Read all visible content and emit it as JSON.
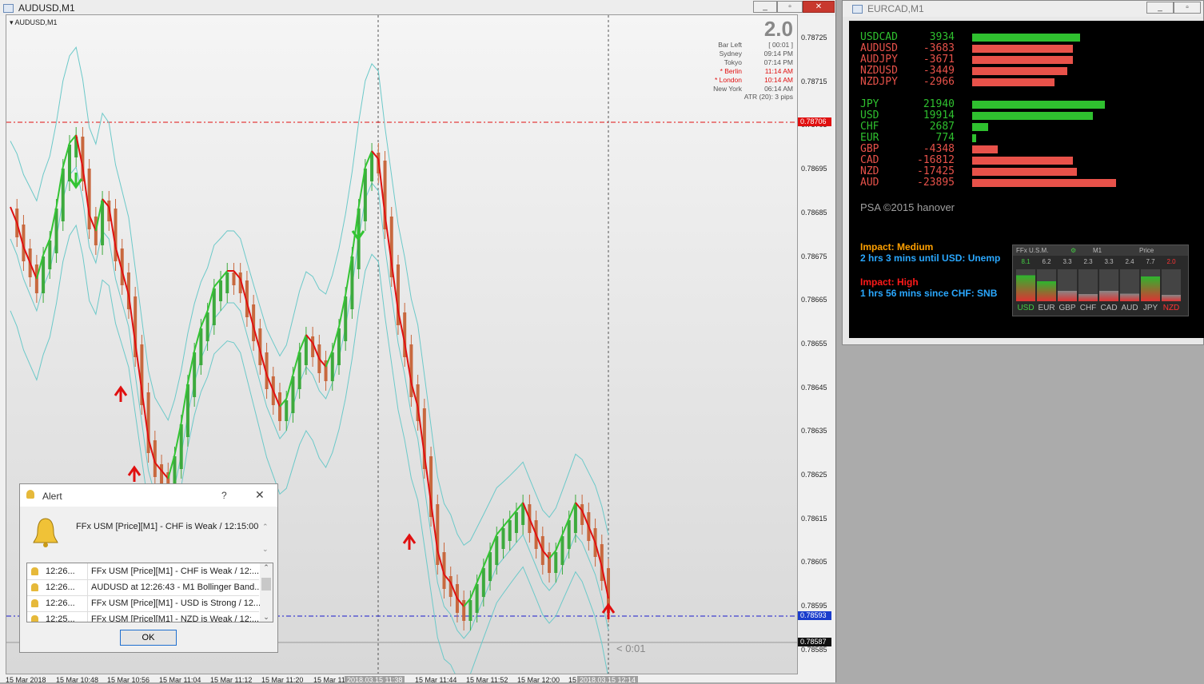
{
  "main_window": {
    "title": "AUDUSD,M1",
    "symbol_label": "AUDUSD,M1",
    "panel_value": "2.0",
    "info": {
      "bar_left_label": "Bar Left",
      "bar_left_value": "[ 00:01 ]",
      "timezones": [
        {
          "name": "Sydney",
          "time": "09:14 PM",
          "active": false
        },
        {
          "name": "Tokyo",
          "time": "07:14 PM",
          "active": false
        },
        {
          "name": "* Berlin",
          "time": "11:14 AM",
          "active": true
        },
        {
          "name": "* London",
          "time": "10:14 AM",
          "active": true
        },
        {
          "name": "New York",
          "time": "06:14 AM",
          "active": false
        }
      ],
      "atr": "ATR (20): 3 pips"
    },
    "price_axis": [
      "0.78725",
      "0.78715",
      "0.78705",
      "0.78695",
      "0.78685",
      "0.78675",
      "0.78665",
      "0.78655",
      "0.78645",
      "0.78635",
      "0.78625",
      "0.78615",
      "0.78605",
      "0.78595",
      "0.78585"
    ],
    "price_tags": {
      "resistance": "0.78706",
      "support": "0.78593",
      "current": "0.78587"
    },
    "time_axis": [
      "15 Mar 2018",
      "15 Mar 10:48",
      "15 Mar 10:56",
      "15 Mar 11:04",
      "15 Mar 11:12",
      "15 Mar 11:20",
      "15 Mar 11",
      "2018.03.15 11:38",
      "15 Mar 11:44",
      "15 Mar 11:52",
      "15 Mar 12:00",
      "15",
      "2018.03.15 12:14"
    ],
    "countdown": "< 0:01",
    "colors": {
      "up_candle": "#3daa3d",
      "down_candle": "#c8683e",
      "band": "#6cc9c9",
      "ma_down": "#e01010",
      "ma_up": "#33c433",
      "resistance": "#e01010",
      "support": "#1a1acc"
    }
  },
  "side_window": {
    "title": "EURCAD,M1",
    "pairs": [
      {
        "name": "USDCAD",
        "value": "3934",
        "strength": 0.75,
        "color": "#2fc02f"
      },
      {
        "name": "AUDUSD",
        "value": "-3683",
        "strength": 0.7,
        "color": "#e8524a"
      },
      {
        "name": "AUDJPY",
        "value": "-3671",
        "strength": 0.7,
        "color": "#e8524a"
      },
      {
        "name": "NZDUSD",
        "value": "-3449",
        "strength": 0.66,
        "color": "#e8524a"
      },
      {
        "name": "NZDJPY",
        "value": "-2966",
        "strength": 0.57,
        "color": "#e8524a"
      }
    ],
    "currencies": [
      {
        "name": "JPY",
        "value": "21940",
        "strength": 0.92,
        "color": "#2fc02f"
      },
      {
        "name": "USD",
        "value": "19914",
        "strength": 0.84,
        "color": "#2fc02f"
      },
      {
        "name": "CHF",
        "value": "2687",
        "strength": 0.11,
        "color": "#2fc02f"
      },
      {
        "name": "EUR",
        "value": "774",
        "strength": 0.03,
        "color": "#2fc02f"
      },
      {
        "name": "GBP",
        "value": "-4348",
        "strength": 0.18,
        "color": "#e8524a"
      },
      {
        "name": "CAD",
        "value": "-16812",
        "strength": 0.7,
        "color": "#e8524a"
      },
      {
        "name": "NZD",
        "value": "-17425",
        "strength": 0.73,
        "color": "#e8524a"
      },
      {
        "name": "AUD",
        "value": "-23895",
        "strength": 1.0,
        "color": "#e8524a"
      }
    ],
    "copyright": "PSA ©2015 hanover",
    "news": [
      {
        "impact": "Impact: Medium",
        "impact_color": "#ffa000",
        "text": "2 hrs 3 mins until USD: Unemp"
      },
      {
        "impact": "Impact: High",
        "impact_color": "#ff1a1a",
        "text": "1 hrs 56 mins since CHF: SNB"
      }
    ],
    "usm_panel": {
      "title": "FFx U.S.M.",
      "timeframe": "M1",
      "mode": "Price",
      "values": [
        "8.1",
        "6.2",
        "3.3",
        "2.3",
        "3.3",
        "2.4",
        "7.7",
        "2.0"
      ],
      "currencies": [
        "USD",
        "EUR",
        "GBP",
        "CHF",
        "CAD",
        "AUD",
        "JPY",
        "NZD"
      ]
    }
  },
  "alert_dialog": {
    "title": "Alert",
    "help": "?",
    "message": "FFx USM [Price][M1] - CHF is Weak / 12:15:00",
    "list": [
      {
        "time": "12:26...",
        "text": "FFx USM [Price][M1] - CHF is Weak / 12:..."
      },
      {
        "time": "12:26...",
        "text": "AUDUSD at 12:26:43 - M1 Bollinger Band..."
      },
      {
        "time": "12:26...",
        "text": "FFx USM [Price][M1] - USD is Strong / 12...."
      },
      {
        "time": "12:25...",
        "text": "FFx USM [Price][M1] - NZD is Weak / 12:..."
      }
    ],
    "ok_label": "OK"
  }
}
